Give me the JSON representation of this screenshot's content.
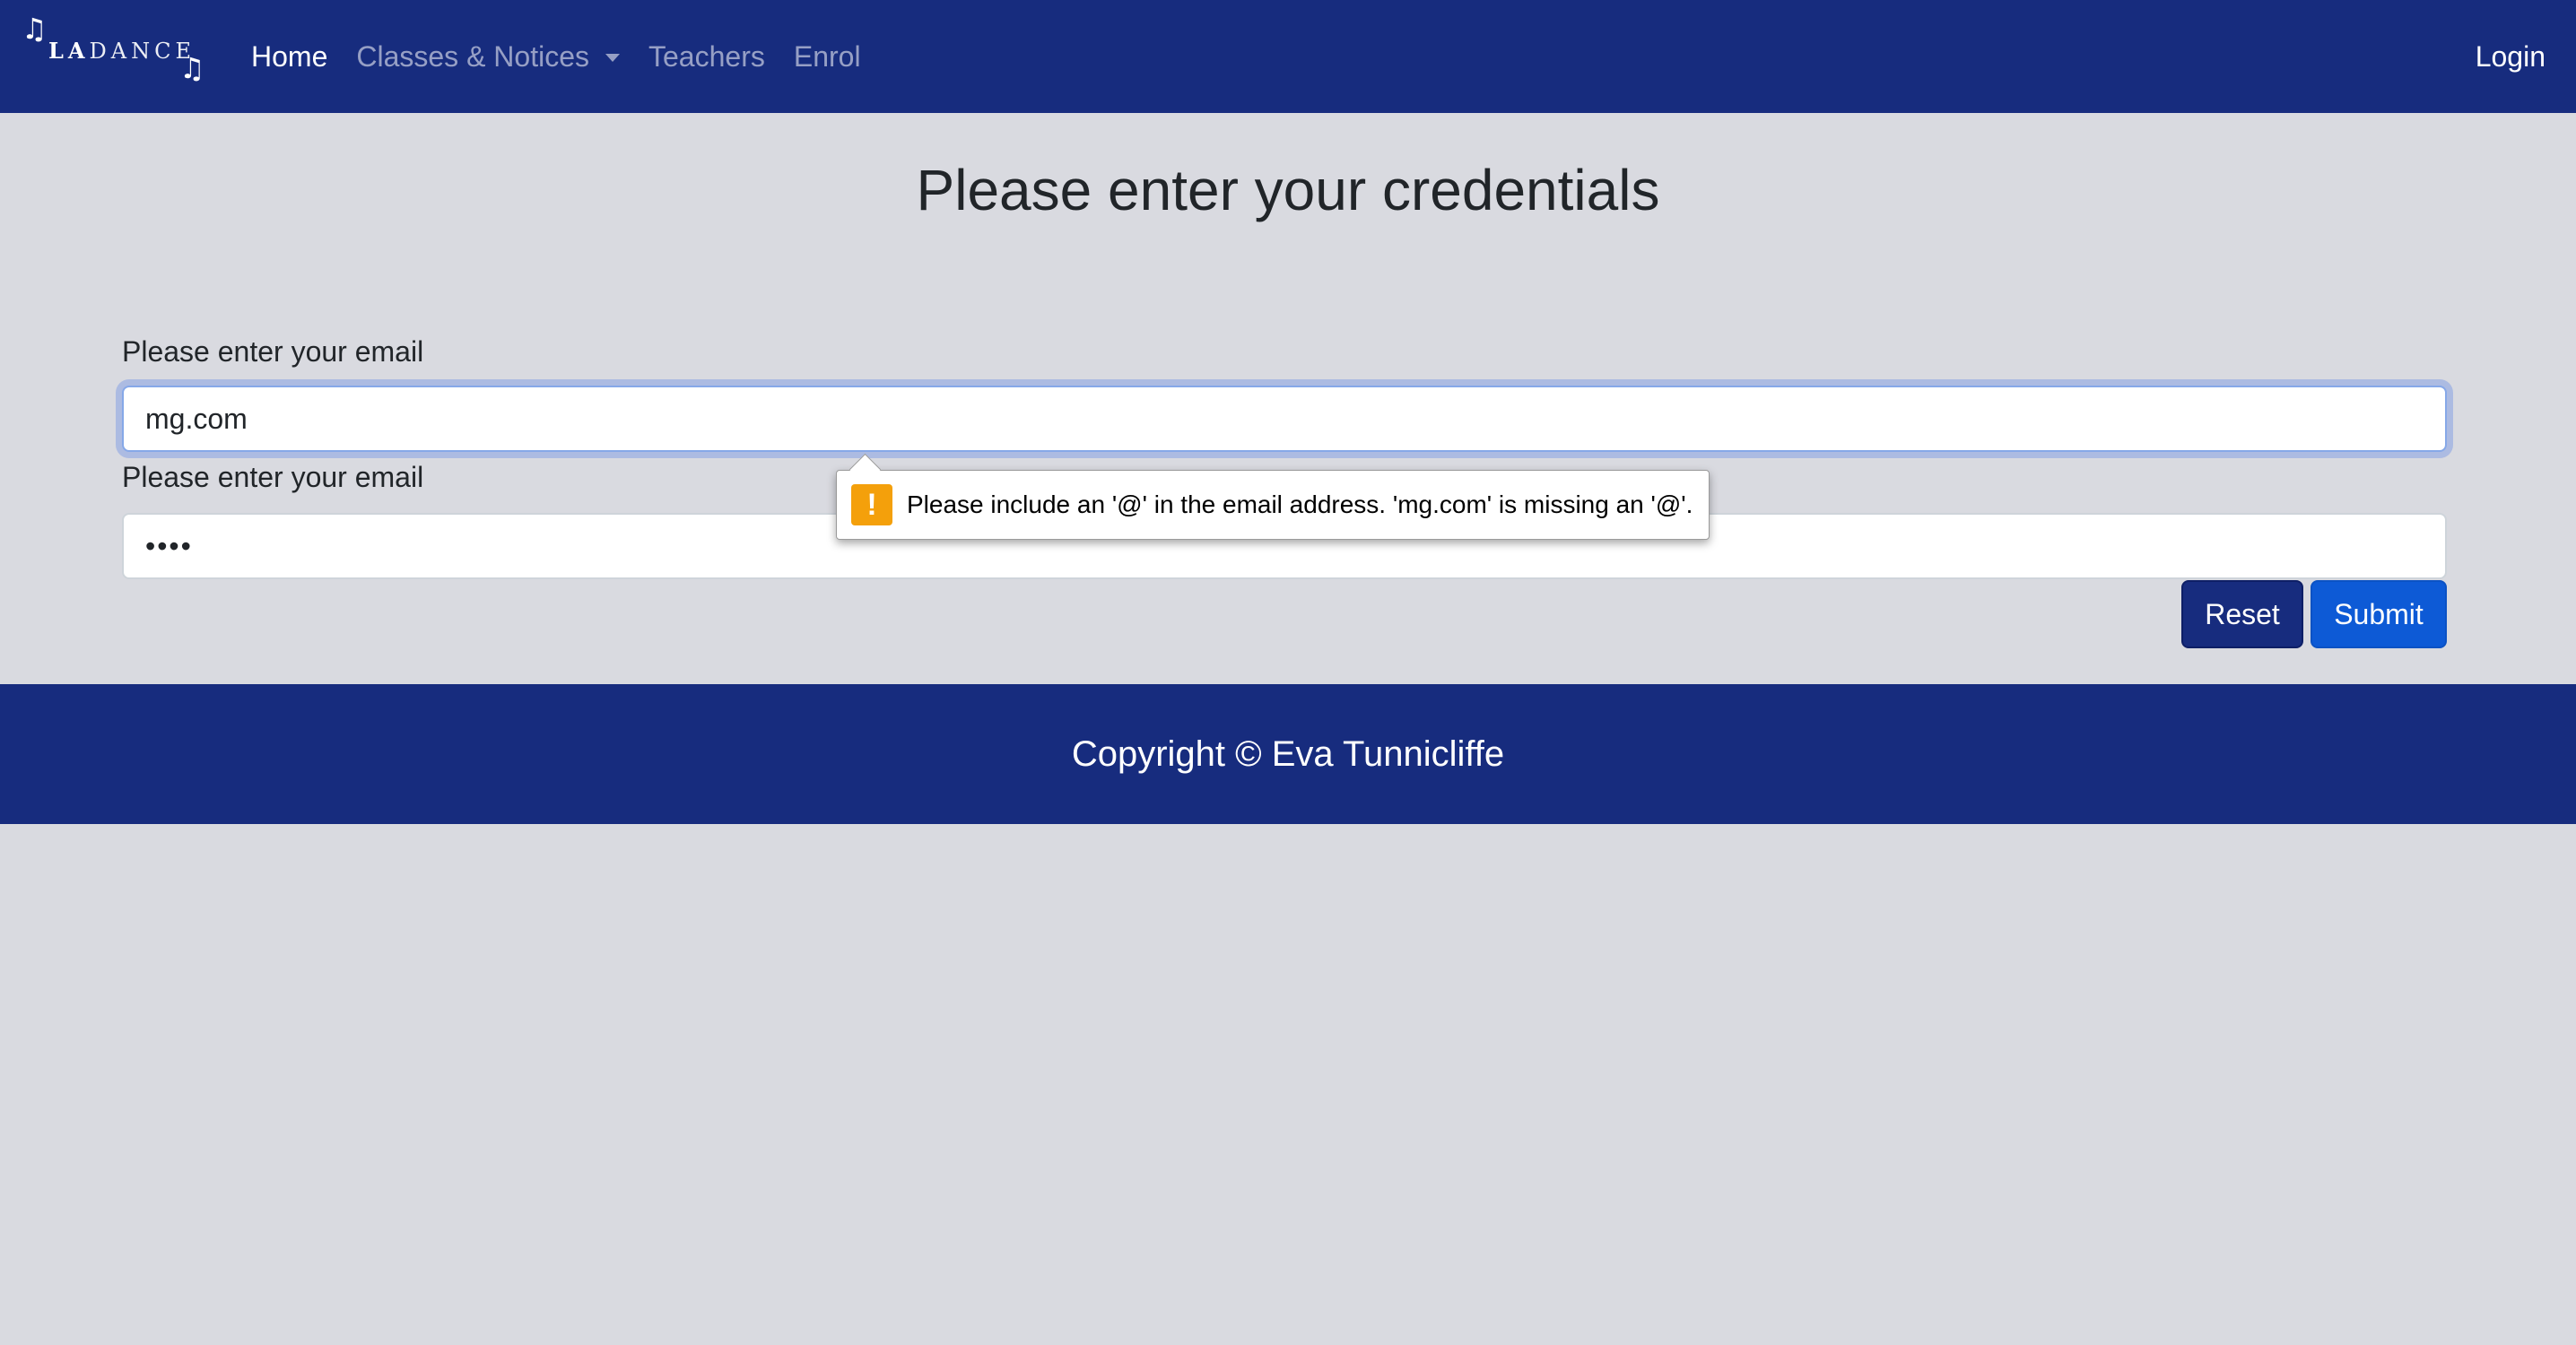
{
  "navbar": {
    "brand": {
      "note_left": "♫",
      "note_right": "♫",
      "logo_strong": "LA",
      "logo_light": "DANCE"
    },
    "links": [
      {
        "label": "Home"
      },
      {
        "label": "Classes & Notices"
      },
      {
        "label": "Teachers"
      },
      {
        "label": "Enrol"
      }
    ],
    "login_label": "Login"
  },
  "colors": {
    "navbar_bg": "#172c7e",
    "page_bg": "#d9dae0",
    "reset_button": "#172c7e",
    "submit_button": "#0d5ad6",
    "warning_icon": "#f4a00b"
  },
  "main": {
    "title": "Please enter your credentials",
    "email_label": "Please enter your email",
    "email_value": "mg.com",
    "password_label": "Please enter your email",
    "password_value": "••••",
    "reset_label": "Reset",
    "submit_label": "Submit"
  },
  "validation": {
    "icon": "warning-icon",
    "icon_glyph": "!",
    "message": "Please include an '@' in the email address. 'mg.com' is missing an '@'."
  },
  "footer": {
    "text": "Copyright © Eva Tunnicliffe"
  }
}
